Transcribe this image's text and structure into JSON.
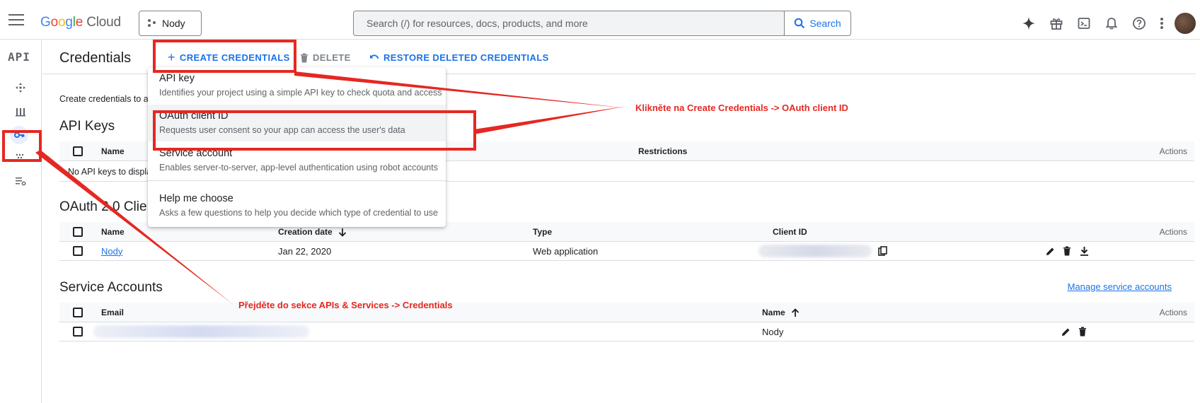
{
  "topbar": {
    "brand_google": [
      "G",
      "o",
      "o",
      "g",
      "l",
      "e"
    ],
    "brand_cloud": "Cloud",
    "project_name": "Nody",
    "search_placeholder": "Search (/) for resources, docs, products, and more",
    "search_button": "Search"
  },
  "rail": {
    "title": "API"
  },
  "actionbar": {
    "title": "Credentials",
    "create_label": "CREATE CREDENTIALS",
    "delete_label": "DELETE",
    "restore_label": "RESTORE DELETED CREDENTIALS"
  },
  "intro_text": "Create credentials to ac",
  "api_keys": {
    "title": "API Keys",
    "columns": {
      "name": "Name",
      "restrictions": "Restrictions",
      "actions": "Actions"
    },
    "empty_text": "No API keys to displa"
  },
  "oauth": {
    "title": "OAuth 2.0 Client I",
    "columns": {
      "name": "Name",
      "creation_date": "Creation date",
      "type": "Type",
      "client_id": "Client ID",
      "actions": "Actions"
    },
    "rows": [
      {
        "name": "Nody",
        "creation_date": "Jan 22, 2020",
        "type": "Web application"
      }
    ]
  },
  "service_accounts": {
    "title": "Service Accounts",
    "manage_link": "Manage service accounts",
    "columns": {
      "email": "Email",
      "name": "Name",
      "actions": "Actions"
    },
    "rows": [
      {
        "name": "Nody"
      }
    ]
  },
  "menu": {
    "items": [
      {
        "label": "API key",
        "desc": "Identifies your project using a simple API key to check quota and access"
      },
      {
        "label": "OAuth client ID",
        "desc": "Requests user consent so your app can access the user's data"
      },
      {
        "label": "Service account",
        "desc": "Enables server-to-server, app-level authentication using robot accounts"
      },
      {
        "label": "Help me choose",
        "desc": "Asks a few questions to help you decide which type of credential to use"
      }
    ]
  },
  "annotations": {
    "text_1": "Klikněte na Create Credentials -> OAuth client ID",
    "text_2": "Přejděte do sekce APIs & Services -> Credentials"
  },
  "colors": {
    "accent": "#1a73e8",
    "annotation": "#e52822"
  }
}
